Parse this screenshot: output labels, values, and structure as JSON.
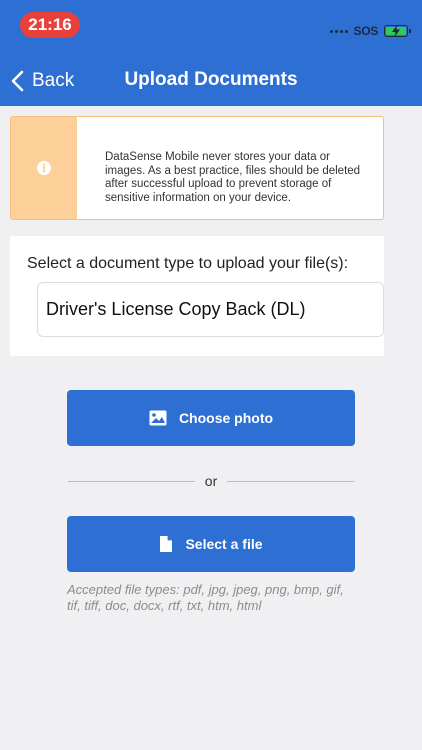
{
  "status_bar": {
    "time": "21:16",
    "sos_label": "SOS"
  },
  "nav": {
    "back_label": "Back",
    "title": "Upload Documents"
  },
  "notice": {
    "icon": "info-icon",
    "text": "DataSense Mobile never stores your data or images. As a best practice, files should be deleted after successful upload to prevent storage of sensitive information on your device."
  },
  "document_type": {
    "label": "Select a document type to upload your file(s):",
    "selected_value": "Driver's License Copy Back (DL)"
  },
  "actions": {
    "choose_photo_label": "Choose photo",
    "divider_label": "or",
    "select_file_label": "Select a file"
  },
  "accepted_types_text": "Accepted file types: pdf, jpg, jpeg, png, bmp, gif, tif, tiff, doc, docx, rtf, txt, htm, html",
  "colors": {
    "header": "#2e6fd3",
    "time_pill": "#e8403a",
    "notice_accent": "#fdd09a",
    "button": "#2e6fd3"
  }
}
